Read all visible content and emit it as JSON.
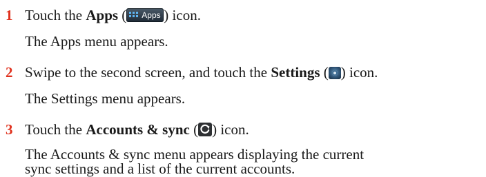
{
  "steps": [
    {
      "number": "1",
      "instruction_pre": "Touch the ",
      "instruction_bold": "Apps",
      "instruction_mid": " (",
      "instruction_post": ") icon.",
      "result": "The Apps menu appears.",
      "icon": {
        "name": "apps-icon",
        "label": "Apps"
      }
    },
    {
      "number": "2",
      "instruction_pre": "Swipe to the second screen, and touch the ",
      "instruction_bold": "Settings",
      "instruction_mid": " (",
      "instruction_post": ") icon.",
      "result": "The Settings menu appears.",
      "icon": {
        "name": "settings-icon"
      }
    },
    {
      "number": "3",
      "instruction_pre": "Touch the ",
      "instruction_bold": "Accounts & sync",
      "instruction_mid": " (",
      "instruction_post": ") icon.",
      "result_line1": "The Accounts & sync menu appears displaying the current",
      "result_line2": "sync settings and a list of the current accounts.",
      "icon": {
        "name": "sync-icon"
      }
    }
  ],
  "colors": {
    "step_number": "#e0311d",
    "text": "#1a1a1a"
  }
}
